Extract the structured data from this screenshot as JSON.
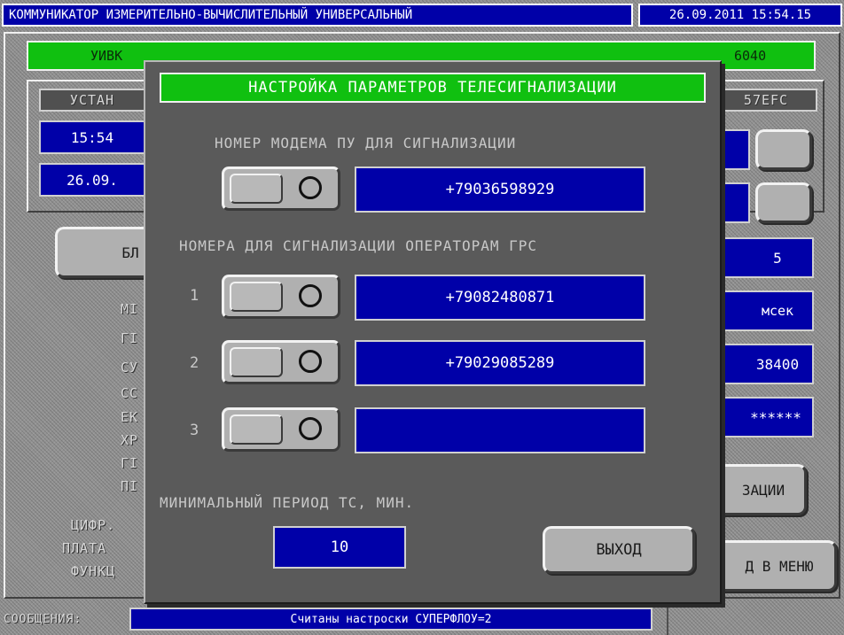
{
  "titlebar": {
    "title": "КОММУНИКАТОР ИЗМЕРИТЕЛЬНО-ВЫЧИСЛИТЕЛЬНЫЙ УНИВЕРСАЛЬНЫЙ",
    "datetime": "26.09.2011 15:54.15"
  },
  "device_bar": {
    "left": "УИВК",
    "right": "6040"
  },
  "background": {
    "left_panel_title": "УСТАН",
    "time_value": "15:54",
    "date_value": "26.09.",
    "block_button": "БЛ",
    "right_title": "57EFC",
    "right_value_1": "5",
    "right_value_2": "мсек",
    "right_value_3": "38400",
    "right_value_4": "******",
    "menu_labels": [
      "МІ",
      "ГІ",
      "СУ",
      "СС",
      "ЕК",
      "ХР",
      "ГІ",
      "ПІ",
      "ЦИФР.",
      "ПЛАТА",
      "ФУНКЦ"
    ],
    "right_button_1": "ЗАЦИИ",
    "right_button_2": "Д В МЕНЮ"
  },
  "dialog": {
    "title": "НАСТРОЙКА ПАРАМЕТРОВ ТЕЛЕСИГНАЛИЗАЦИИ",
    "modem_label": "НОМЕР МОДЕМА ПУ ДЛЯ СИГНАЛИЗАЦИИ",
    "modem_number": "+79036598929",
    "operators_label": "НОМЕРА ДЛЯ СИГНАЛИЗАЦИИ ОПЕРАТОРАМ ГРС",
    "operators": [
      {
        "index": "1",
        "number": "+79082480871"
      },
      {
        "index": "2",
        "number": "+79029085289"
      },
      {
        "index": "3",
        "number": ""
      }
    ],
    "min_period_label": "МИНИМАЛЬНЫЙ ПЕРИОД ТС, МИН.",
    "min_period_value": "10",
    "exit_button": "ВЫХОД"
  },
  "statusbar": {
    "label": "СООБЩЕНИЯ:",
    "message": "Считаны настроски СУПЕРФЛОУ=2"
  },
  "colors": {
    "accent_green": "#10c010",
    "field_blue": "#0000a8",
    "panel_gray": "#8c8c8c"
  }
}
